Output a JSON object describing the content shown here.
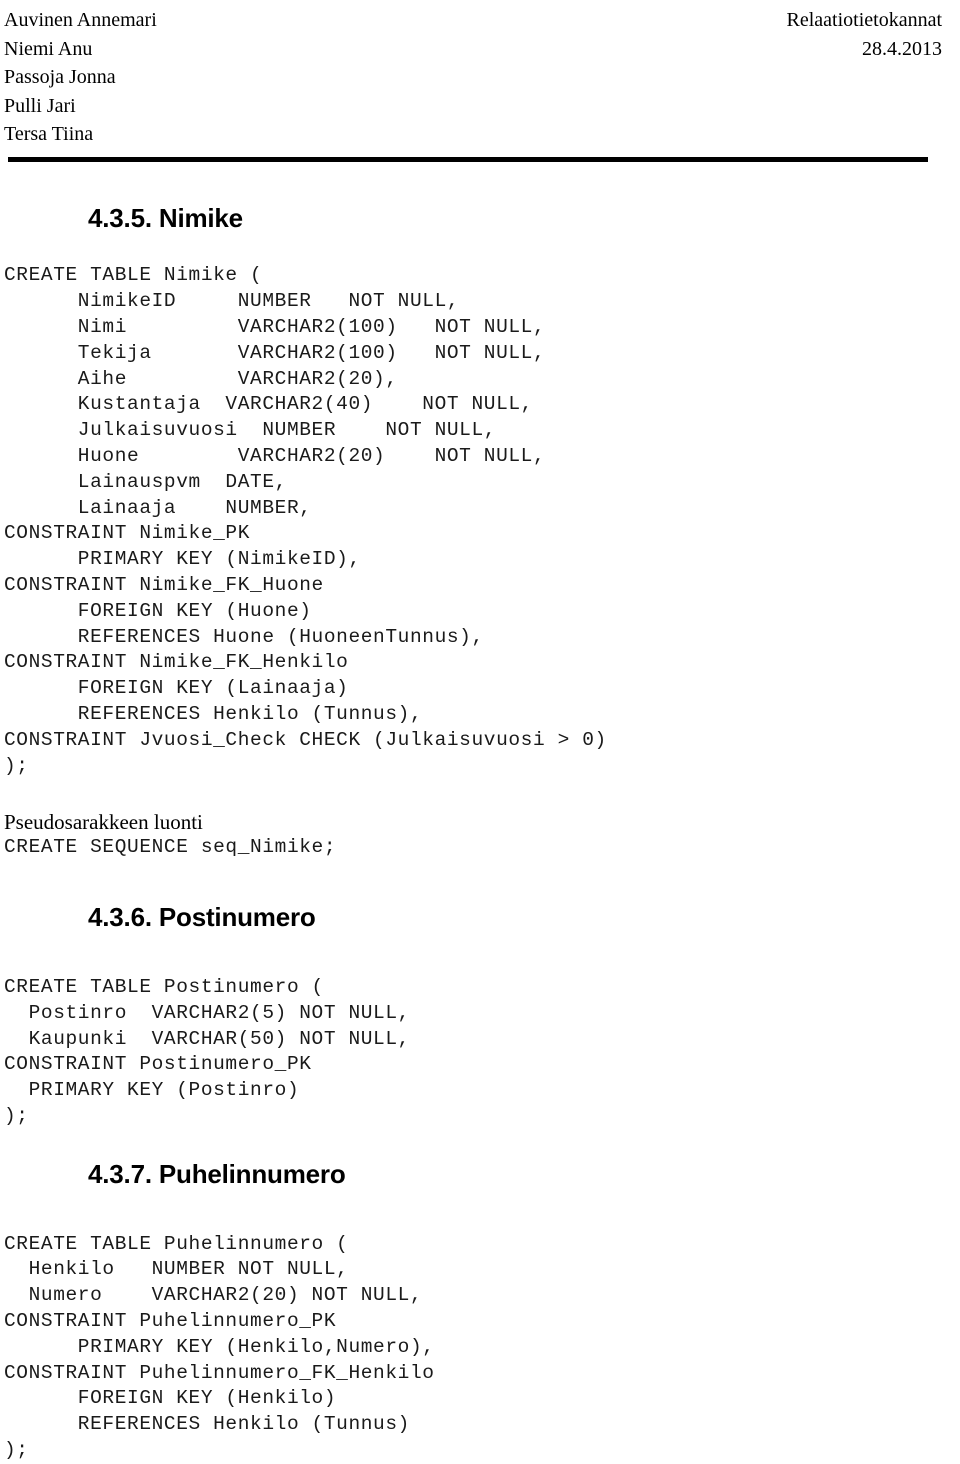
{
  "header": {
    "rows": [
      {
        "left": "Auvinen Annemari",
        "right": "Relaatiotietokannat"
      },
      {
        "left": "Niemi Anu",
        "right": "28.4.2013"
      },
      {
        "left": "Passoja Jonna",
        "right": ""
      },
      {
        "left": "Pulli Jari",
        "right": ""
      },
      {
        "left": "Tersa Tiina",
        "right": ""
      }
    ]
  },
  "sections": {
    "nimike": {
      "heading": "4.3.5. Nimike",
      "code": "CREATE TABLE Nimike (\n      NimikeID     NUMBER   NOT NULL,\n      Nimi         VARCHAR2(100)   NOT NULL,\n      Tekija       VARCHAR2(100)   NOT NULL,\n      Aihe         VARCHAR2(20),\n      Kustantaja  VARCHAR2(40)    NOT NULL,\n      Julkaisuvuosi  NUMBER    NOT NULL,\n      Huone        VARCHAR2(20)    NOT NULL,\n      Lainauspvm  DATE,\n      Lainaaja    NUMBER,\nCONSTRAINT Nimike_PK\n      PRIMARY KEY (NimikeID),\nCONSTRAINT Nimike_FK_Huone\n      FOREIGN KEY (Huone)\n      REFERENCES Huone (HuoneenTunnus),\nCONSTRAINT Nimike_FK_Henkilo\n      FOREIGN KEY (Lainaaja)\n      REFERENCES Henkilo (Tunnus),\nCONSTRAINT Jvuosi_Check CHECK (Julkaisuvuosi > 0)\n);",
      "sequence_caption": "Pseudosarakkeen luonti",
      "sequence_code": "CREATE SEQUENCE seq_Nimike;"
    },
    "postinumero": {
      "heading": "4.3.6. Postinumero",
      "code": "CREATE TABLE Postinumero (\n  Postinro  VARCHAR2(5) NOT NULL,\n  Kaupunki  VARCHAR(50) NOT NULL,\nCONSTRAINT Postinumero_PK\n  PRIMARY KEY (Postinro)\n);"
    },
    "puhelinnumero": {
      "heading": "4.3.7. Puhelinnumero",
      "code": "CREATE TABLE Puhelinnumero (\n  Henkilo   NUMBER NOT NULL,\n  Numero    VARCHAR2(20) NOT NULL,\nCONSTRAINT Puhelinnumero_PK\n      PRIMARY KEY (Henkilo,Numero),\nCONSTRAINT Puhelinnumero_FK_Henkilo\n      FOREIGN KEY (Henkilo)\n      REFERENCES Henkilo (Tunnus)\n);"
    }
  }
}
